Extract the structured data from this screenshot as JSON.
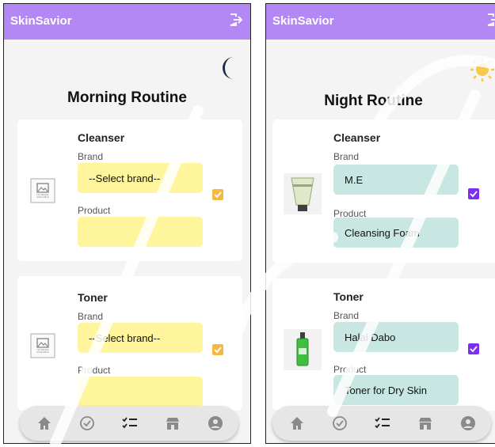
{
  "app": {
    "title": "SkinSavior"
  },
  "screens": [
    {
      "title": "Morning Routine",
      "mode_icon": "moon-icon",
      "sections": [
        {
          "heading": "Cleanser",
          "brand_label": "Brand",
          "brand_value": "--Select brand--",
          "product_label": "Product",
          "product_value": "",
          "image": "no-image-available-icon",
          "no_image_text": "NO IMAGE AVAILABLE",
          "checked": true
        },
        {
          "heading": "Toner",
          "brand_label": "Brand",
          "brand_value": "--Select brand--",
          "product_label": "Product",
          "product_value": "",
          "image": "no-image-available-icon",
          "no_image_text": "NO IMAGE AVAILABLE",
          "checked": true
        }
      ]
    },
    {
      "title": "Night Routine",
      "mode_icon": "sun-icon",
      "sections": [
        {
          "heading": "Cleanser",
          "brand_label": "Brand",
          "brand_value": "M.E",
          "product_label": "Product",
          "product_value": "Cleansing Foam",
          "image": "cleanser-tube-image",
          "checked": true
        },
        {
          "heading": "Toner",
          "brand_label": "Brand",
          "brand_value": "Halal Dabo",
          "product_label": "Product",
          "product_value": "Toner for Dry Skin",
          "image": "toner-bottle-image",
          "checked": true
        }
      ]
    }
  ],
  "nav": [
    "home-icon",
    "check-circle-icon",
    "checklist-icon",
    "shop-icon",
    "account-icon"
  ],
  "colors": {
    "appbar": "#b388f5",
    "checkbox_morning": "#f5b942",
    "checkbox_night": "#7b2ff0",
    "field_morning": "#fff59d",
    "field_night": "#c9e7e2"
  }
}
